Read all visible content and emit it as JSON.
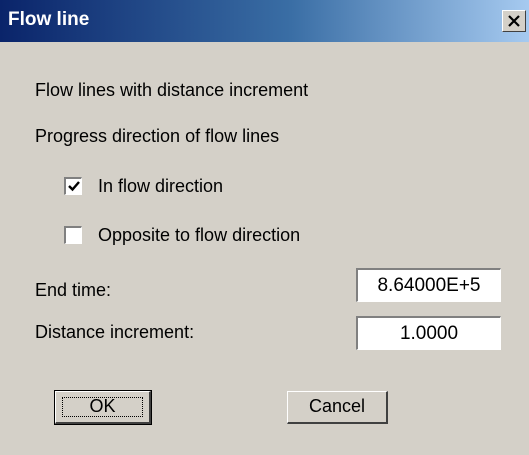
{
  "window": {
    "title": "Flow line",
    "close_glyph": "✕"
  },
  "labels": {
    "heading": "Flow lines with distance increment",
    "direction_heading": "Progress direction of flow lines",
    "in_flow": "In flow direction",
    "opposite_flow": "Opposite to flow direction",
    "end_time": "End time:",
    "distance_increment": "Distance increment:"
  },
  "checkboxes": {
    "in_flow_checked": true,
    "opposite_flow_checked": false
  },
  "inputs": {
    "end_time_value": "8.64000E+5",
    "distance_increment_value": "1.0000"
  },
  "buttons": {
    "ok": "OK",
    "cancel": "Cancel"
  },
  "colors": {
    "dialog_bg": "#d4d0c8",
    "title_start": "#0a246a",
    "title_end": "#a6caf0"
  }
}
